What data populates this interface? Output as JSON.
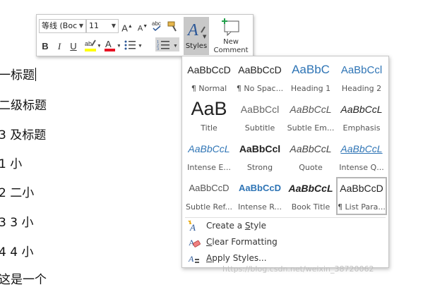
{
  "document": {
    "lines": [
      "一标题",
      "二级标题",
      "3 及标题",
      "1    小",
      "2    二小",
      "3    3 小",
      "4    4 小",
      "这是一个"
    ]
  },
  "mini_toolbar": {
    "font_name": "等线 (Boc",
    "font_size": "11",
    "grow_font": "A",
    "shrink_font": "A",
    "bold": "B",
    "italic": "I",
    "underline": "U",
    "highlight_color": "#ffff00",
    "font_color": "#e81123",
    "styles_label": "Styles",
    "new_comment_label_1": "New",
    "new_comment_label_2": "Comment",
    "accent_color": "#2b5797"
  },
  "styles_gallery": {
    "rows": [
      [
        {
          "sample": "AaBbCcD",
          "name": "¶ Normal"
        },
        {
          "sample": "AaBbCcD",
          "name": "¶ No Spac..."
        },
        {
          "sample": "AaBbC",
          "name": "Heading 1"
        },
        {
          "sample": "AaBbCcl",
          "name": "Heading 2"
        }
      ],
      [
        {
          "sample": "AaB",
          "name": "Title"
        },
        {
          "sample": "AaBbCcl",
          "name": "Subtitle"
        },
        {
          "sample": "AaBbCcL",
          "name": "Subtle Em..."
        },
        {
          "sample": "AaBbCcL",
          "name": "Emphasis"
        }
      ],
      [
        {
          "sample": "AaBbCcL",
          "name": "Intense E..."
        },
        {
          "sample": "AaBbCcl",
          "name": "Strong"
        },
        {
          "sample": "AaBbCcL",
          "name": "Quote"
        },
        {
          "sample": "AaBbCcL",
          "name": "Intense Q..."
        }
      ],
      [
        {
          "sample": "AaBbCcD",
          "name": "Subtle Ref..."
        },
        {
          "sample": "AaBbCcD",
          "name": "Intense R..."
        },
        {
          "sample": "AaBbCcL",
          "name": "Book Title"
        },
        {
          "sample": "AaBbCcD",
          "name": "¶ List Para..."
        }
      ]
    ],
    "commands": {
      "create_style_pre": "Create a ",
      "create_style_key": "S",
      "create_style_post": "tyle",
      "clear_formatting_pre": "",
      "clear_formatting_key": "C",
      "clear_formatting_post": "lear Formatting",
      "apply_styles_pre": "",
      "apply_styles_key": "A",
      "apply_styles_post": "pply Styles..."
    }
  },
  "watermark": "https://blog.csdn.net/weixin_38720062"
}
